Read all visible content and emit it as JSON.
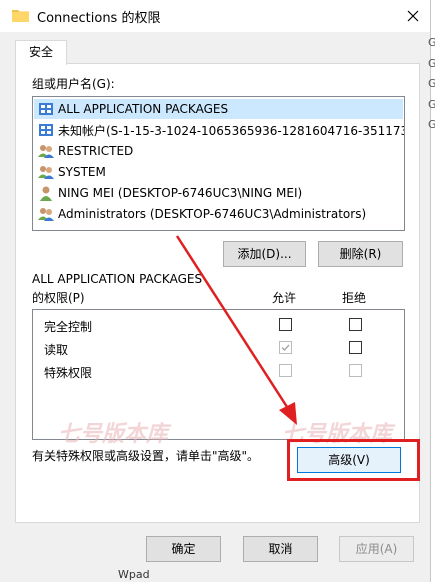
{
  "window": {
    "title": "Connections 的权限",
    "icon": "folder-icon"
  },
  "tabs": [
    {
      "label": "安全"
    }
  ],
  "groups_label": "组或用户名(G):",
  "principals": [
    {
      "name": "ALL APPLICATION PACKAGES",
      "icon": "package-group-icon",
      "selected": true
    },
    {
      "name": "未知帐户(S-1-15-3-1024-1065365936-1281604716-351173...",
      "icon": "unknown-account-icon",
      "selected": false
    },
    {
      "name": "RESTRICTED",
      "icon": "group-icon",
      "selected": false
    },
    {
      "name": "SYSTEM",
      "icon": "group-icon",
      "selected": false
    },
    {
      "name": "NING MEI (DESKTOP-6746UC3\\NING MEI)",
      "icon": "user-icon",
      "selected": false
    },
    {
      "name": "Administrators (DESKTOP-6746UC3\\Administrators)",
      "icon": "group-icon",
      "selected": false
    }
  ],
  "buttons": {
    "add": "添加(D)...",
    "remove": "删除(R)",
    "advanced": "高级(V)",
    "ok": "确定",
    "cancel": "取消",
    "apply": "应用(A)"
  },
  "permissions": {
    "for_label": "ALL APPLICATION PACKAGES",
    "of_label": "的权限(P)",
    "allow_header": "允许",
    "deny_header": "拒绝",
    "rows": [
      {
        "name": "完全控制",
        "allow": false,
        "deny": false,
        "disabled": false
      },
      {
        "name": "读取",
        "allow": true,
        "deny": false,
        "disabled": false
      },
      {
        "name": "特殊权限",
        "allow": false,
        "deny": false,
        "disabled": true
      }
    ]
  },
  "advanced_hint": "有关特殊权限或高级设置，请单击\"高级\"。",
  "watermark": "七号版本库",
  "background_peek": {
    "right_letters": [
      "G",
      "G",
      "G",
      "G",
      "G"
    ],
    "bottom_text": "Wpad"
  },
  "annotation_color": "#e02020"
}
